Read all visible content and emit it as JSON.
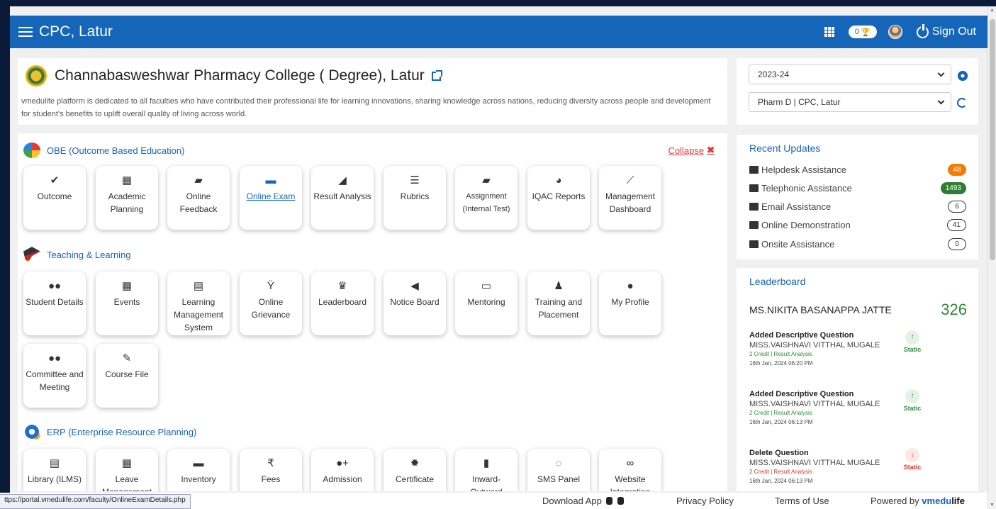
{
  "header": {
    "title": "CPC, Latur",
    "badge_count": "0",
    "signout_label": "Sign Out"
  },
  "college": {
    "name": "Channabasweshwar Pharmacy College ( Degree), Latur",
    "description": "vmedulife platform is dedicated to all faculties who have contributed their professional life for learning innovations, sharing knowledge across nations, reducing diversity across people and development for student's benefits to uplift overall quality of living across world."
  },
  "obe": {
    "title": "OBE (Outcome Based Education)",
    "collapse_label": "Collapse",
    "tiles": [
      {
        "label": "Outcome",
        "icon": "✔"
      },
      {
        "label": "Academic Planning",
        "icon": "▦"
      },
      {
        "label": "Online Feedback",
        "icon": "▰"
      },
      {
        "label": "Online Exam",
        "icon": "▬"
      },
      {
        "label": "Result Analysis",
        "icon": "◢"
      },
      {
        "label": "Rubrics",
        "icon": "☰"
      },
      {
        "label": "Assignment (Internal Test)",
        "icon": "▰"
      },
      {
        "label": "IQAC Reports",
        "icon": "◕"
      },
      {
        "label": "Management Dashboard",
        "icon": "⟋"
      }
    ]
  },
  "teaching": {
    "title": "Teaching & Learning",
    "tiles": [
      {
        "label": "Student Details",
        "icon": "●●"
      },
      {
        "label": "Events",
        "icon": "▦"
      },
      {
        "label": "Learning Management System",
        "icon": "▤"
      },
      {
        "label": "Online Grievance",
        "icon": "Ÿ"
      },
      {
        "label": "Leaderboard",
        "icon": "♛"
      },
      {
        "label": "Notice Board",
        "icon": "◀"
      },
      {
        "label": "Mentoring",
        "icon": "▭"
      },
      {
        "label": "Training and Placement",
        "icon": "♟"
      },
      {
        "label": "My Profile",
        "icon": "●"
      },
      {
        "label": "Committee and Meeting",
        "icon": "●●"
      },
      {
        "label": "Course File",
        "icon": "✎"
      }
    ]
  },
  "erp": {
    "title": "ERP (Enterprise Resource Planning)",
    "tiles": [
      {
        "label": "Library (ILMS)",
        "icon": "▤"
      },
      {
        "label": "Leave Management",
        "icon": "▦"
      },
      {
        "label": "Inventory",
        "icon": "▬"
      },
      {
        "label": "Fees",
        "icon": "₹"
      },
      {
        "label": "Admission",
        "icon": "●+"
      },
      {
        "label": "Certificate",
        "icon": "✹"
      },
      {
        "label": "Inward-Outward",
        "icon": "▮"
      },
      {
        "label": "SMS Panel",
        "icon": "◌"
      },
      {
        "label": "Website Integration",
        "icon": "∞"
      }
    ]
  },
  "selectors": {
    "year": "2023-24",
    "program": "Pharm D | CPC, Latur"
  },
  "updates": {
    "title": "Recent Updates",
    "items": [
      {
        "label": "Helpdesk Assistance",
        "count": "48"
      },
      {
        "label": "Telephonic Assistance",
        "count": "1493"
      },
      {
        "label": "Email Assistance",
        "count": "6"
      },
      {
        "label": "Online Demonstration",
        "count": "41"
      },
      {
        "label": "Onsite Assistance",
        "count": "0"
      }
    ]
  },
  "leaderboard": {
    "title": "Leaderboard",
    "top_name": "MS.NIKITA BASANAPPA JATTE",
    "top_score": "326",
    "activities": [
      {
        "action": "Added Descriptive Question",
        "user": "MISS.VAISHNAVI VITTHAL MUGALE",
        "meta": "2 Credit | Result Analysis",
        "time": "16th Jan, 2024 06:20 PM",
        "status": "Static",
        "arrow": "↑"
      },
      {
        "action": "Added Descriptive Question",
        "user": "MISS.VAISHNAVI VITTHAL MUGALE",
        "meta": "2 Credit | Result Analysis",
        "time": "16th Jan, 2024 06:13 PM",
        "status": "Static",
        "arrow": "↑"
      },
      {
        "action": "Delete Question",
        "user": "MISS.VAISHNAVI VITTHAL MUGALE",
        "meta": "2 Credit | Result Analysis",
        "time": "16th Jan, 2024 06:13 PM",
        "status": "Static",
        "arrow": "↓"
      }
    ]
  },
  "footer": {
    "status_url": "ttps://portal.vmedulife.com/faculty/OnlineExamDetails.php",
    "download_app": "Download App",
    "privacy": "Privacy Policy",
    "terms": "Terms of Use",
    "powered_by": "Powered by",
    "brand_a": "vmedu",
    "brand_b": "life"
  },
  "colors": {
    "header_bg": "#1565b8",
    "accent": "#1565b8",
    "orange_badge": "#f57c00",
    "green_badge": "#2e7d32",
    "collapse_red": "#e53935"
  }
}
